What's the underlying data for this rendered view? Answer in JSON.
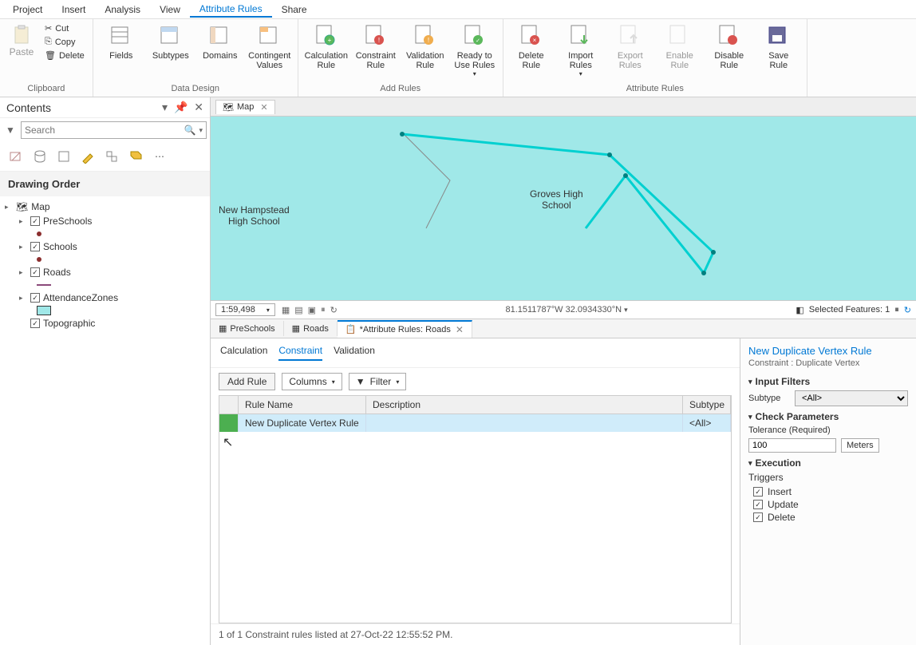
{
  "menu": {
    "items": [
      "Project",
      "Insert",
      "Analysis",
      "View",
      "Attribute Rules",
      "Share"
    ],
    "active": "Attribute Rules"
  },
  "ribbon": {
    "clipboard": {
      "paste": "Paste",
      "cut": "Cut",
      "copy": "Copy",
      "delete": "Delete",
      "group": "Clipboard"
    },
    "data_design": {
      "fields": "Fields",
      "subtypes": "Subtypes",
      "domains": "Domains",
      "contingent": "Contingent\nValues",
      "group": "Data Design"
    },
    "add_rules": {
      "calc": "Calculation\nRule",
      "constraint": "Constraint\nRule",
      "validation": "Validation\nRule",
      "ready": "Ready to\nUse Rules",
      "group": "Add Rules"
    },
    "attr_rules": {
      "delete": "Delete\nRule",
      "import": "Import\nRules",
      "export": "Export\nRules",
      "enable": "Enable\nRule",
      "disable": "Disable\nRule",
      "save": "Save\nRule",
      "group": "Attribute Rules"
    }
  },
  "contents": {
    "title": "Contents",
    "search_placeholder": "Search",
    "drawing_order": "Drawing Order",
    "map": "Map",
    "layers": [
      "PreSchools",
      "Schools",
      "Roads",
      "AttendanceZones",
      "Topographic"
    ]
  },
  "map": {
    "tab": "Map",
    "label1": "New Hampstead\nHigh School",
    "label2": "Groves High\nSchool",
    "scale": "1:59,498",
    "coords": "81.1511787°W 32.0934330°N",
    "selected": "Selected Features: 1"
  },
  "bottom_tabs": {
    "t1": "PreSchools",
    "t2": "Roads",
    "t3": "*Attribute Rules: Roads"
  },
  "ar": {
    "subtabs": [
      "Calculation",
      "Constraint",
      "Validation"
    ],
    "active_subtab": "Constraint",
    "add_rule": "Add Rule",
    "columns": "Columns",
    "filter": "Filter",
    "headers": {
      "name": "Rule Name",
      "desc": "Description",
      "subtype": "Subtype"
    },
    "row": {
      "name": "New Duplicate Vertex Rule",
      "desc": "",
      "subtype": "<All>"
    },
    "footer": "1 of 1 Constraint rules listed at 27-Oct-22 12:55:52 PM."
  },
  "panel": {
    "title": "New Duplicate Vertex Rule",
    "subtitle": "Constraint : Duplicate Vertex",
    "input_filters": "Input Filters",
    "subtype_label": "Subtype",
    "subtype_value": "<All>",
    "check_params": "Check Parameters",
    "tolerance_label": "Tolerance (Required)",
    "tolerance_value": "100",
    "tolerance_unit": "Meters",
    "execution": "Execution",
    "triggers": "Triggers",
    "insert": "Insert",
    "update": "Update",
    "delete": "Delete"
  }
}
